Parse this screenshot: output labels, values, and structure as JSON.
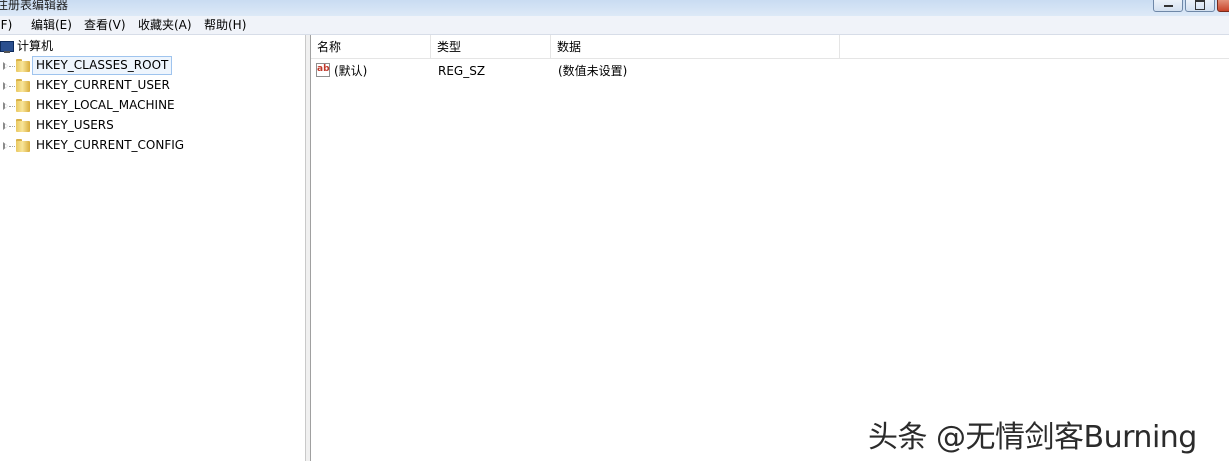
{
  "window": {
    "title": "注册表编辑器"
  },
  "menu": [
    {
      "label": "文件(F)",
      "display": "(F)"
    },
    {
      "label": "编辑(E)"
    },
    {
      "label": "查看(V)"
    },
    {
      "label": "收藏夹(A)"
    },
    {
      "label": "帮助(H)"
    }
  ],
  "tree": {
    "root": {
      "label": "计算机",
      "icon": "computer-icon"
    },
    "nodes": [
      {
        "label": "HKEY_CLASSES_ROOT",
        "icon": "folder-icon",
        "selected": true
      },
      {
        "label": "HKEY_CURRENT_USER",
        "icon": "folder-icon"
      },
      {
        "label": "HKEY_LOCAL_MACHINE",
        "icon": "folder-icon"
      },
      {
        "label": "HKEY_USERS",
        "icon": "folder-icon"
      },
      {
        "label": "HKEY_CURRENT_CONFIG",
        "icon": "folder-icon"
      }
    ]
  },
  "list": {
    "columns": [
      "名称",
      "类型",
      "数据"
    ],
    "rows": [
      {
        "name": "(默认)",
        "type": "REG_SZ",
        "data": "(数值未设置)",
        "icon": "string-value-icon"
      }
    ]
  },
  "watermark": "头条 @无情剑客Burning"
}
